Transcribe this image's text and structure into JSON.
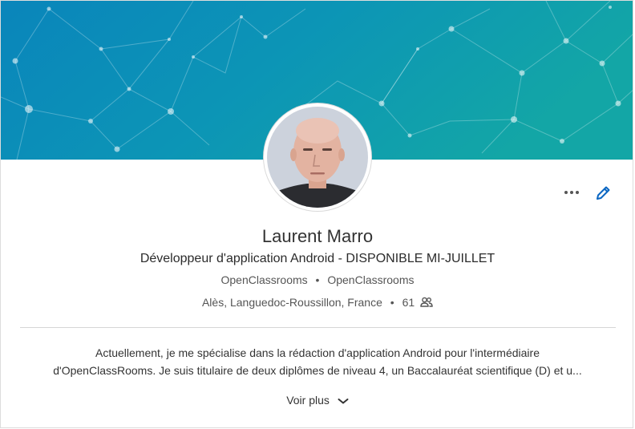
{
  "profile": {
    "name": "Laurent Marro",
    "headline": "Développeur d'application Android - DISPONIBLE MI-JUILLET",
    "company_current": "OpenClassrooms",
    "company_school": "OpenClassrooms",
    "location": "Alès, Languedoc-Roussillon, France",
    "connections": "61",
    "summary_line1": "Actuellement, je me spécialise dans la rédaction d'application Android pour l'intermédiaire",
    "summary_line2": "d'OpenClassRooms. Je suis titulaire de deux diplômes de niveau 4, un Baccalauréat scientifique (D) et u...",
    "see_more": "Voir plus"
  },
  "icons": {
    "more": "more-horizontal-icon",
    "edit": "pencil-icon",
    "connections": "people-icon",
    "expand": "chevron-down-icon"
  },
  "colors": {
    "banner_left": "#0a86b9",
    "banner_right": "#12a3a8",
    "accent": "#0a66c2"
  }
}
